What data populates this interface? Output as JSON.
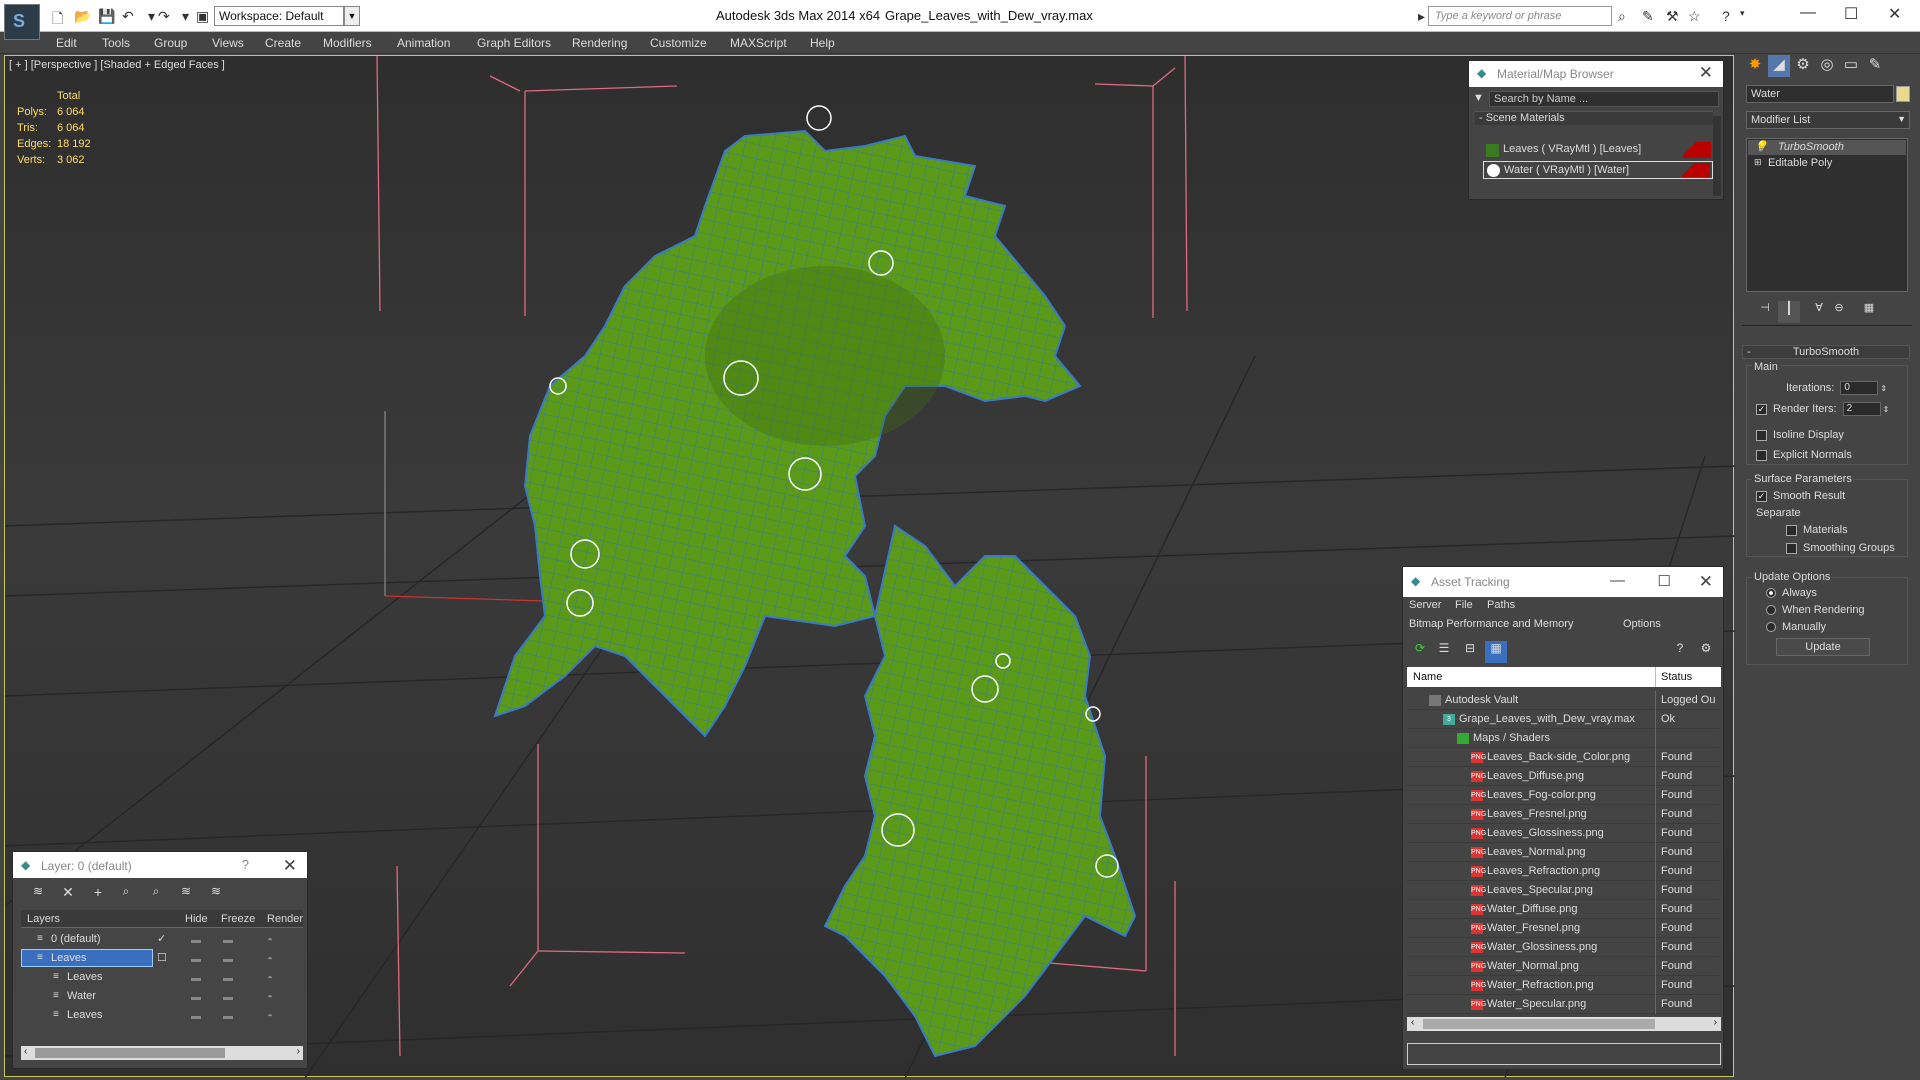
{
  "app": {
    "title": "Autodesk 3ds Max  2014 x64",
    "file": "Grape_Leaves_with_Dew_vray.max",
    "workspace": "Workspace: Default",
    "search_placeholder": "Type a keyword or phrase"
  },
  "menu": [
    "Edit",
    "Tools",
    "Group",
    "Views",
    "Create",
    "Modifiers",
    "Animation",
    "Graph Editors",
    "Rendering",
    "Customize",
    "MAXScript",
    "Help"
  ],
  "viewport": {
    "label": "[ + ] [Perspective ] [Shaded + Edged Faces ]",
    "stats": {
      "header": "Total",
      "rows": [
        {
          "label": "Polys:",
          "value": "6 064"
        },
        {
          "label": "Tris:",
          "value": "6 064"
        },
        {
          "label": "Edges:",
          "value": "18 192"
        },
        {
          "label": "Verts:",
          "value": "3 062"
        }
      ]
    }
  },
  "material_browser": {
    "title": "Material/Map Browser",
    "search": "Search by Name ...",
    "section": "- Scene Materials",
    "items": [
      "Leaves  ( VRayMtl )  [Leaves]",
      "Water  ( VRayMtl )  [Water]"
    ]
  },
  "command_panel": {
    "object_name": "Water",
    "modifier_list": "Modifier List",
    "stack": [
      "TurboSmooth",
      "Editable Poly"
    ],
    "turbosmooth": {
      "header": "TurboSmooth",
      "main": "Main",
      "iterations_label": "Iterations:",
      "iterations": "0",
      "render_iters_label": "Render Iters:",
      "render_iters": "2",
      "isoline": "Isoline Display",
      "explicit_normals": "Explicit Normals",
      "surface_params": "Surface Parameters",
      "smooth_result": "Smooth Result",
      "separate": "Separate",
      "materials": "Materials",
      "smoothing_groups": "Smoothing Groups",
      "update_options": "Update Options",
      "always": "Always",
      "when_rendering": "When Rendering",
      "manually": "Manually",
      "update_button": "Update"
    }
  },
  "asset_tracking": {
    "title": "Asset Tracking",
    "menu": [
      "Server",
      "File",
      "Paths"
    ],
    "menu2": [
      "Bitmap Performance and Memory",
      "Options"
    ],
    "columns": [
      "Name",
      "Status"
    ],
    "rows": [
      {
        "name": "Autodesk Vault",
        "status": "Logged Ou",
        "indent": 1,
        "kind": "vault"
      },
      {
        "name": "Grape_Leaves_with_Dew_vray.max",
        "status": "Ok",
        "indent": 2,
        "kind": "max"
      },
      {
        "name": "Maps / Shaders",
        "status": "",
        "indent": 3,
        "kind": "folder"
      },
      {
        "name": "Leaves_Back-side_Color.png",
        "status": "Found",
        "indent": 4,
        "kind": "png"
      },
      {
        "name": "Leaves_Diffuse.png",
        "status": "Found",
        "indent": 4,
        "kind": "png"
      },
      {
        "name": "Leaves_Fog-color.png",
        "status": "Found",
        "indent": 4,
        "kind": "png"
      },
      {
        "name": "Leaves_Fresnel.png",
        "status": "Found",
        "indent": 4,
        "kind": "png"
      },
      {
        "name": "Leaves_Glossiness.png",
        "status": "Found",
        "indent": 4,
        "kind": "png"
      },
      {
        "name": "Leaves_Normal.png",
        "status": "Found",
        "indent": 4,
        "kind": "png"
      },
      {
        "name": "Leaves_Refraction.png",
        "status": "Found",
        "indent": 4,
        "kind": "png"
      },
      {
        "name": "Leaves_Specular.png",
        "status": "Found",
        "indent": 4,
        "kind": "png"
      },
      {
        "name": "Water_Diffuse.png",
        "status": "Found",
        "indent": 4,
        "kind": "png"
      },
      {
        "name": "Water_Fresnel.png",
        "status": "Found",
        "indent": 4,
        "kind": "png"
      },
      {
        "name": "Water_Glossiness.png",
        "status": "Found",
        "indent": 4,
        "kind": "png"
      },
      {
        "name": "Water_Normal.png",
        "status": "Found",
        "indent": 4,
        "kind": "png"
      },
      {
        "name": "Water_Refraction.png",
        "status": "Found",
        "indent": 4,
        "kind": "png"
      },
      {
        "name": "Water_Specular.png",
        "status": "Found",
        "indent": 4,
        "kind": "png"
      }
    ]
  },
  "layer_manager": {
    "title": "Layer: 0 (default)",
    "help": "?",
    "columns": [
      "Layers",
      "Hide",
      "Freeze",
      "Render"
    ],
    "rows": [
      {
        "name": "0 (default)",
        "indent": 1,
        "selected": false
      },
      {
        "name": "Leaves",
        "indent": 1,
        "selected": true
      },
      {
        "name": "Leaves",
        "indent": 2,
        "selected": false
      },
      {
        "name": "Water",
        "indent": 2,
        "selected": false
      },
      {
        "name": "Leaves",
        "indent": 2,
        "selected": false
      }
    ]
  }
}
